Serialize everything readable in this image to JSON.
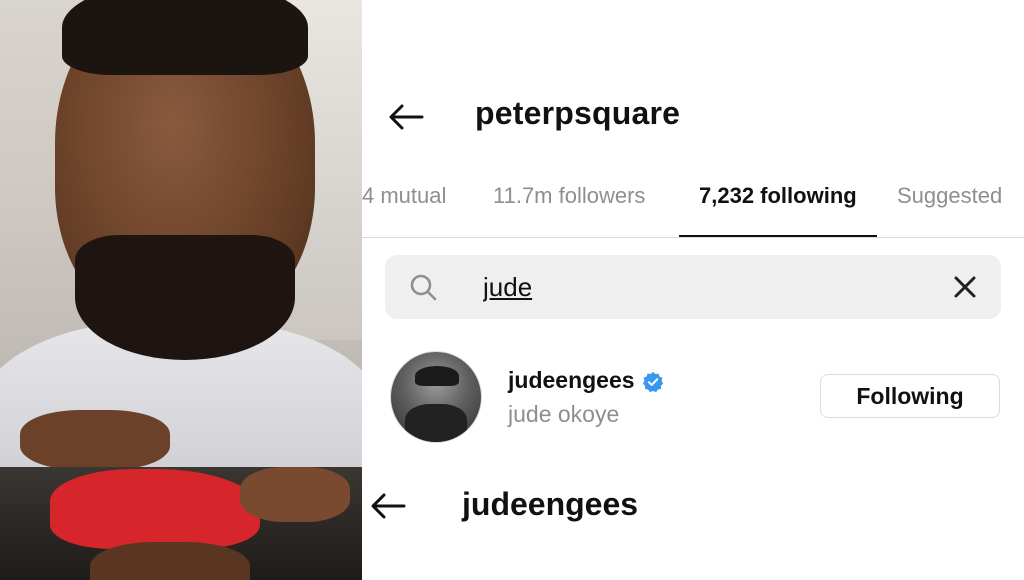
{
  "profile": {
    "username": "peterpsquare"
  },
  "tabs": [
    {
      "label": "4 mutual",
      "active": false
    },
    {
      "label": "11.7m followers",
      "active": false
    },
    {
      "label": "7,232 following",
      "active": true
    },
    {
      "label": "Suggested",
      "active": false
    }
  ],
  "search": {
    "value": "jude",
    "search_icon": "search-icon",
    "clear_icon": "close-icon"
  },
  "results": [
    {
      "handle": "judeengees",
      "name": "jude okoye",
      "verified": true,
      "button_label": "Following"
    }
  ],
  "second_profile": {
    "username": "judeengees"
  },
  "colors": {
    "verified": "#3897f0",
    "muted": "#8e8e8e",
    "search_bg": "#efefef",
    "divider": "#dbdbdb"
  }
}
